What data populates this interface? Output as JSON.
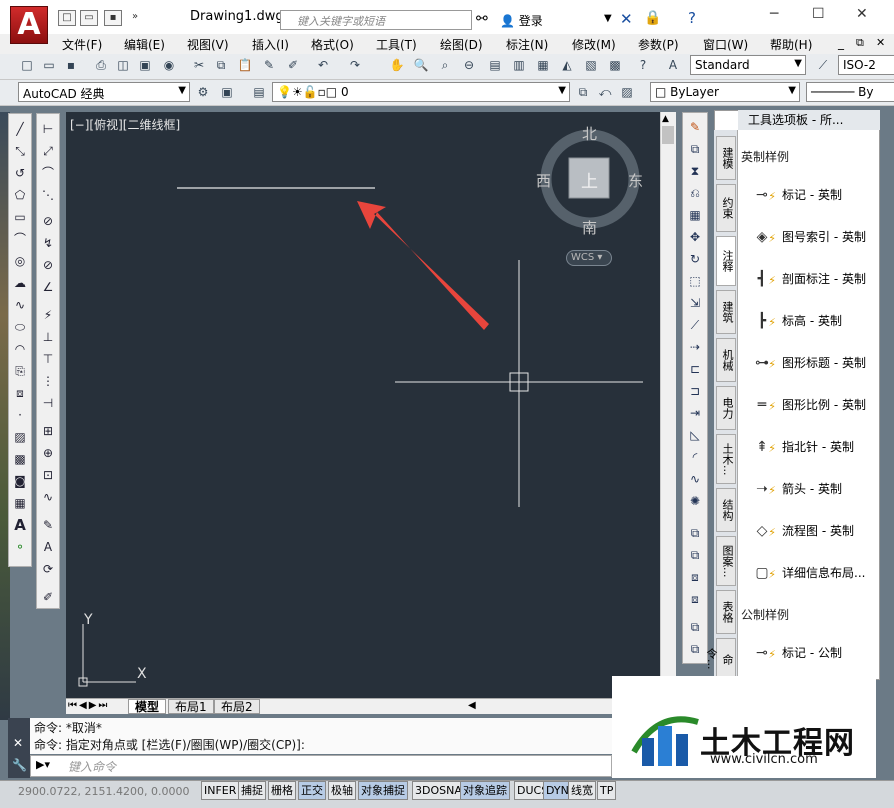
{
  "titlebar": {
    "app_logo": "A",
    "doc_title": "Drawing1.dwg",
    "search_placeholder": "键入关键字或短语",
    "login_label": "登录"
  },
  "menu": [
    "文件(F)",
    "编辑(E)",
    "视图(V)",
    "插入(I)",
    "格式(O)",
    "工具(T)",
    "绘图(D)",
    "标注(N)",
    "修改(M)",
    "参数(P)",
    "窗口(W)",
    "帮助(H)"
  ],
  "toolbar": {
    "text_style": "Standard",
    "dim_style": "ISO-2",
    "workspace": "AutoCAD 经典",
    "layer": "0",
    "color": "ByLayer",
    "linetype": "By"
  },
  "viewport": {
    "label": "[−][俯视][二维线框]",
    "compass": {
      "north": "北",
      "south": "南",
      "east": "东",
      "west": "西",
      "top": "上"
    },
    "wcs": "WCS",
    "ucs_y": "Y",
    "ucs_x": "X"
  },
  "layout_tabs": [
    "模型",
    "布局1",
    "布局2"
  ],
  "palette": {
    "title": "工具选项板 - 所...",
    "tabs": [
      "建模",
      "约束",
      "注释",
      "建筑",
      "机械",
      "电力",
      "土木...",
      "结构",
      "图案...",
      "表格",
      "命令..."
    ],
    "section1": "英制样例",
    "items": [
      "标记 - 英制",
      "图号索引 - 英制",
      "剖面标注 - 英制",
      "标高 - 英制",
      "图形标题 - 英制",
      "图形比例 - 英制",
      "指北针 - 英制",
      "箭头 - 英制",
      "流程图 - 英制",
      "详细信息布局..."
    ],
    "section2": "公制样例",
    "items2": [
      "标记 - 公制"
    ]
  },
  "command": {
    "line1": "命令: *取消*",
    "line2": "命令: 指定对角点或 [栏选(F)/圈围(WP)/圈交(CP)]:",
    "placeholder": "键入命令"
  },
  "status": {
    "coords": "2900.0722, 2151.4200, 0.0000",
    "buttons": [
      "INFER",
      "捕捉",
      "栅格",
      "正交",
      "极轴",
      "对象捕捉",
      "3DOSNAP",
      "对象追踪",
      "DUCS",
      "DYN",
      "线宽",
      "TP"
    ]
  },
  "watermark": {
    "title": "土木工程网",
    "url": "www.civilcn.com"
  },
  "colors": {
    "canvas": "#27303a",
    "arrow": "#e8453c",
    "accent": "#c0181d"
  }
}
